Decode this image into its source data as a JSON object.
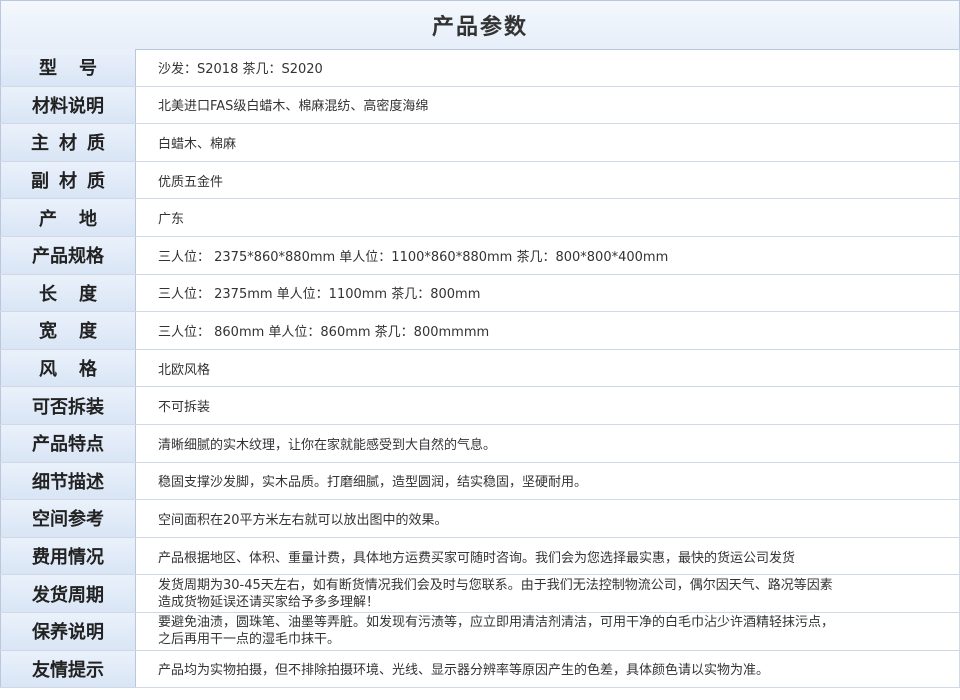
{
  "title": "产品参数",
  "rows": [
    {
      "label": "型号",
      "value": "沙发：S2018 茶几：S2020"
    },
    {
      "label": "材料说明",
      "value": "北美进口FAS级白蜡木、棉麻混纺、高密度海绵"
    },
    {
      "label": "主材质",
      "value": "白蜡木、棉麻"
    },
    {
      "label": "副材质",
      "value": "优质五金件"
    },
    {
      "label": "产地",
      "value": "广东"
    },
    {
      "label": "产品规格",
      "value": "三人位： 2375*860*880mm  单人位：1100*860*880mm  茶几：800*800*400mm"
    },
    {
      "label": "长度",
      "value": "三人位： 2375mm  单人位：1100mm  茶几：800mm"
    },
    {
      "label": "宽度",
      "value": "三人位： 860mm  单人位：860mm  茶几：800mmmm"
    },
    {
      "label": "风格",
      "value": "北欧风格"
    },
    {
      "label": "可否拆装",
      "value": "不可拆装"
    },
    {
      "label": "产品特点",
      "value": "清晰细腻的实木纹理，让你在家就能感受到大自然的气息。"
    },
    {
      "label": "细节描述",
      "value": "稳固支撑沙发脚，实木品质。打磨细腻，造型圆润，结实稳固，坚硬耐用。"
    },
    {
      "label": "空间参考",
      "value": "空间面积在20平方米左右就可以放出图中的效果。"
    },
    {
      "label": "费用情况",
      "value": "产品根据地区、体积、重量计费，具体地方运费买家可随时咨询。我们会为您选择最实惠，最快的货运公司发货"
    },
    {
      "label": "发货周期",
      "value": "发货周期为30-45天左右，如有断货情况我们会及时与您联系。由于我们无法控制物流公司，偶尔因天气、路况等因素\n造成货物延误还请买家给予多多理解！"
    },
    {
      "label": "保养说明",
      "value": "要避免油渍，圆珠笔、油墨等弄脏。如发现有污渍等，应立即用清洁剂清洁，可用干净的白毛巾沾少许酒精轻抹污点，\n之后再用干一点的湿毛巾抹干。"
    },
    {
      "label": "友情提示",
      "value": "产品均为实物拍摄，但不排除拍摄环境、光线、显示器分辨率等原因产生的色差，具体颜色请以实物为准。"
    }
  ]
}
